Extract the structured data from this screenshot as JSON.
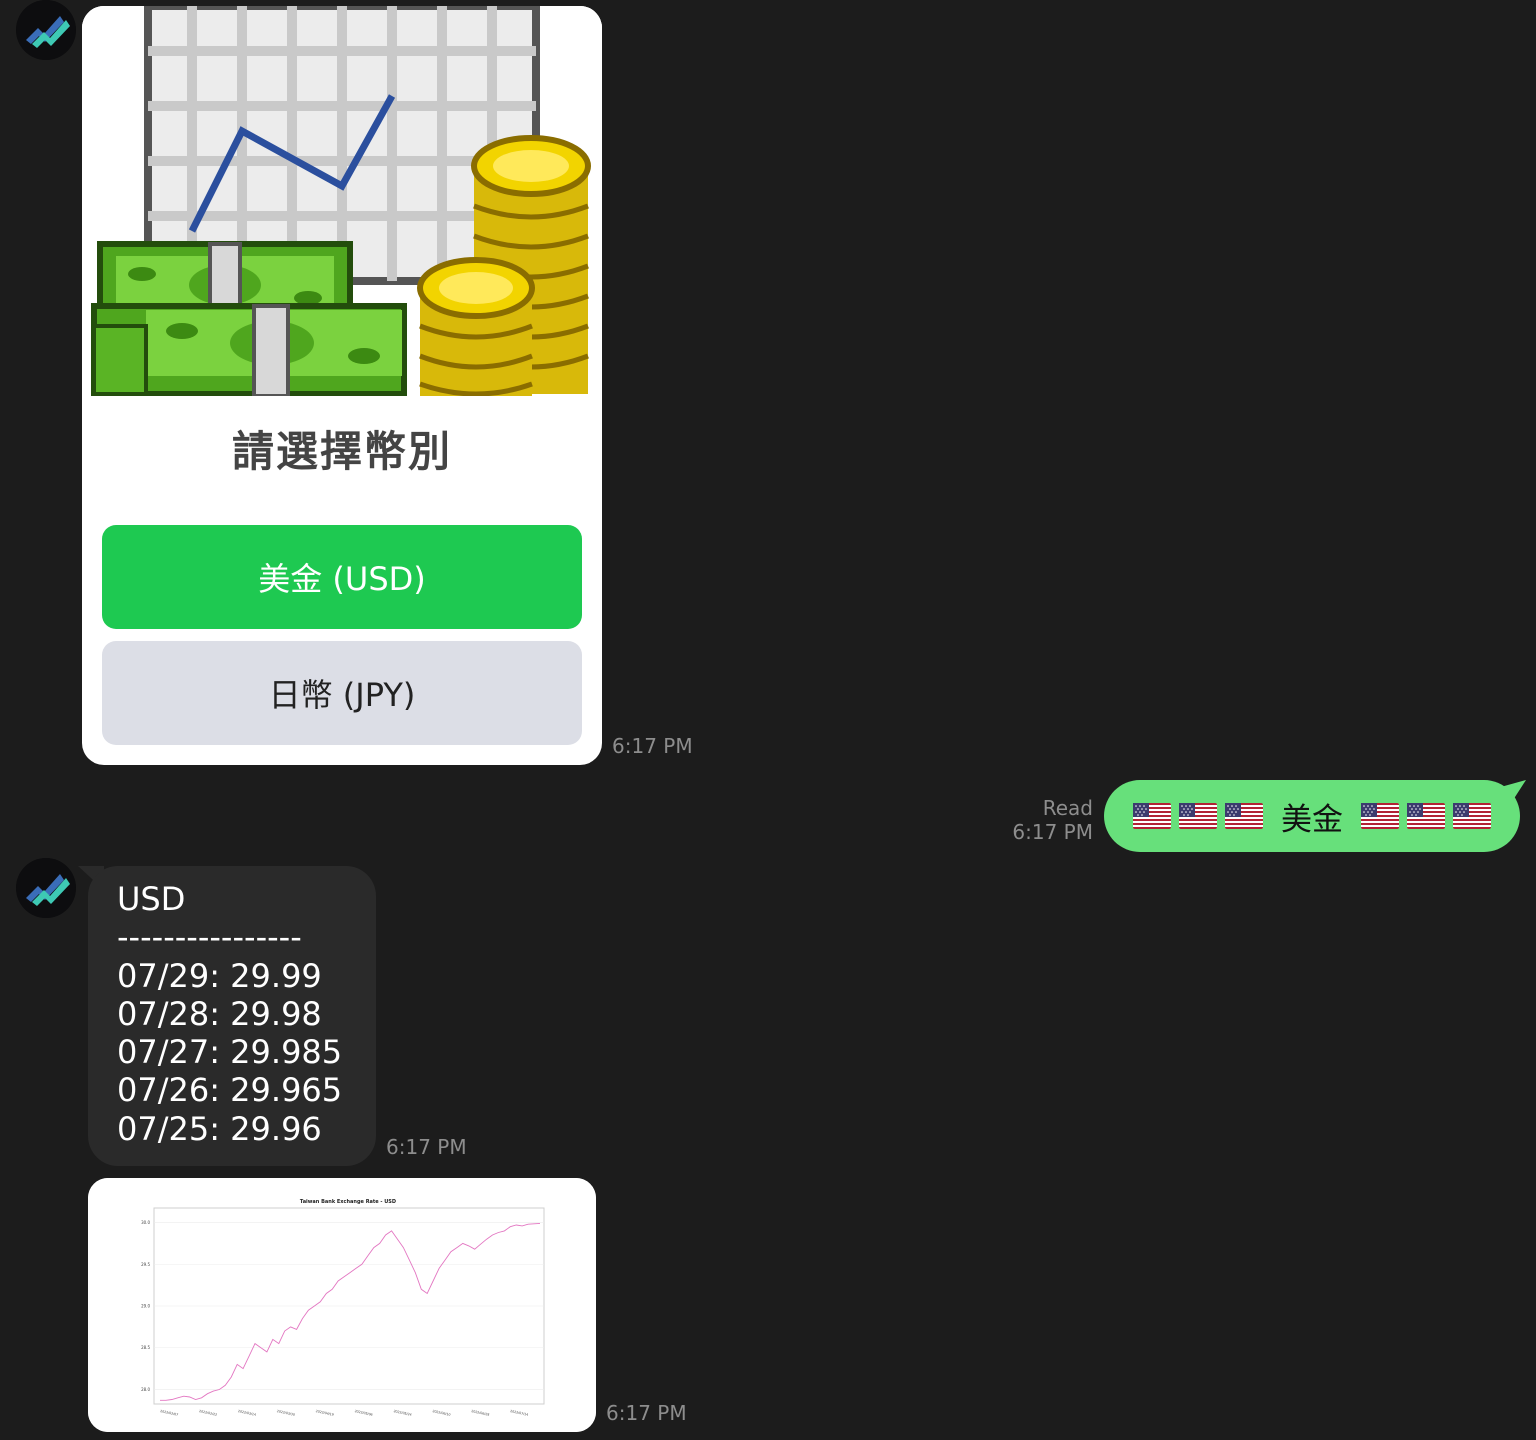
{
  "bot": {
    "avatar_icon": "bot-avatar-chart-icon"
  },
  "flex_card": {
    "hero_image": "exchange-rate-money-illustration",
    "title": "請選擇幣別",
    "buttons": [
      {
        "label": "美金 (USD)",
        "color": "#1ec951"
      },
      {
        "label": "日幣 (JPY)",
        "color": "#dcdee6"
      }
    ],
    "time": "6:17 PM"
  },
  "user_message": {
    "text": "美金",
    "flag": "us-flag-emoji",
    "flags_before": 3,
    "flags_after": 3,
    "status": "Read",
    "time": "6:17 PM",
    "bubble_color": "#67e07b"
  },
  "rates_message": {
    "lines": [
      "USD",
      "----------------",
      "07/29: 29.99",
      "07/28: 29.98",
      "07/27: 29.985",
      "07/26: 29.965",
      "07/25: 29.96"
    ],
    "time": "6:17 PM"
  },
  "chart_message": {
    "time": "6:17 PM",
    "chart_data": {
      "type": "line",
      "title": "Taiwan Bank Exchange Rate - USD",
      "xlabel": "",
      "ylabel": "",
      "y_ticks": [
        "28.0",
        "28.5",
        "29.0",
        "29.5",
        "30.0"
      ],
      "ylim": [
        27.85,
        30.15
      ],
      "x_ticks": [
        "2022/02/07",
        "2022/02/22",
        "2022/03/14",
        "2022/03/30",
        "2022/04/19",
        "2022/05/06",
        "2022/05/24",
        "2022/06/10",
        "2022/06/28",
        "2022/07/14"
      ],
      "line_color": "#e377c2",
      "grid": true,
      "series": [
        {
          "values": [
            27.87,
            27.87,
            27.88,
            27.9,
            27.92,
            27.91,
            27.88,
            27.9,
            27.95,
            27.98,
            28.0,
            28.05,
            28.15,
            28.3,
            28.25,
            28.4,
            28.55,
            28.5,
            28.45,
            28.6,
            28.55,
            28.7,
            28.75,
            28.72,
            28.85,
            28.95,
            29.0,
            29.05,
            29.15,
            29.2,
            29.3,
            29.35,
            29.4,
            29.45,
            29.5,
            29.6,
            29.7,
            29.75,
            29.85,
            29.9,
            29.8,
            29.7,
            29.55,
            29.4,
            29.2,
            29.15,
            29.3,
            29.45,
            29.55,
            29.65,
            29.7,
            29.75,
            29.72,
            29.68,
            29.74,
            29.8,
            29.85,
            29.88,
            29.9,
            29.95,
            29.97,
            29.96,
            29.98,
            29.985,
            29.99
          ]
        }
      ]
    }
  }
}
